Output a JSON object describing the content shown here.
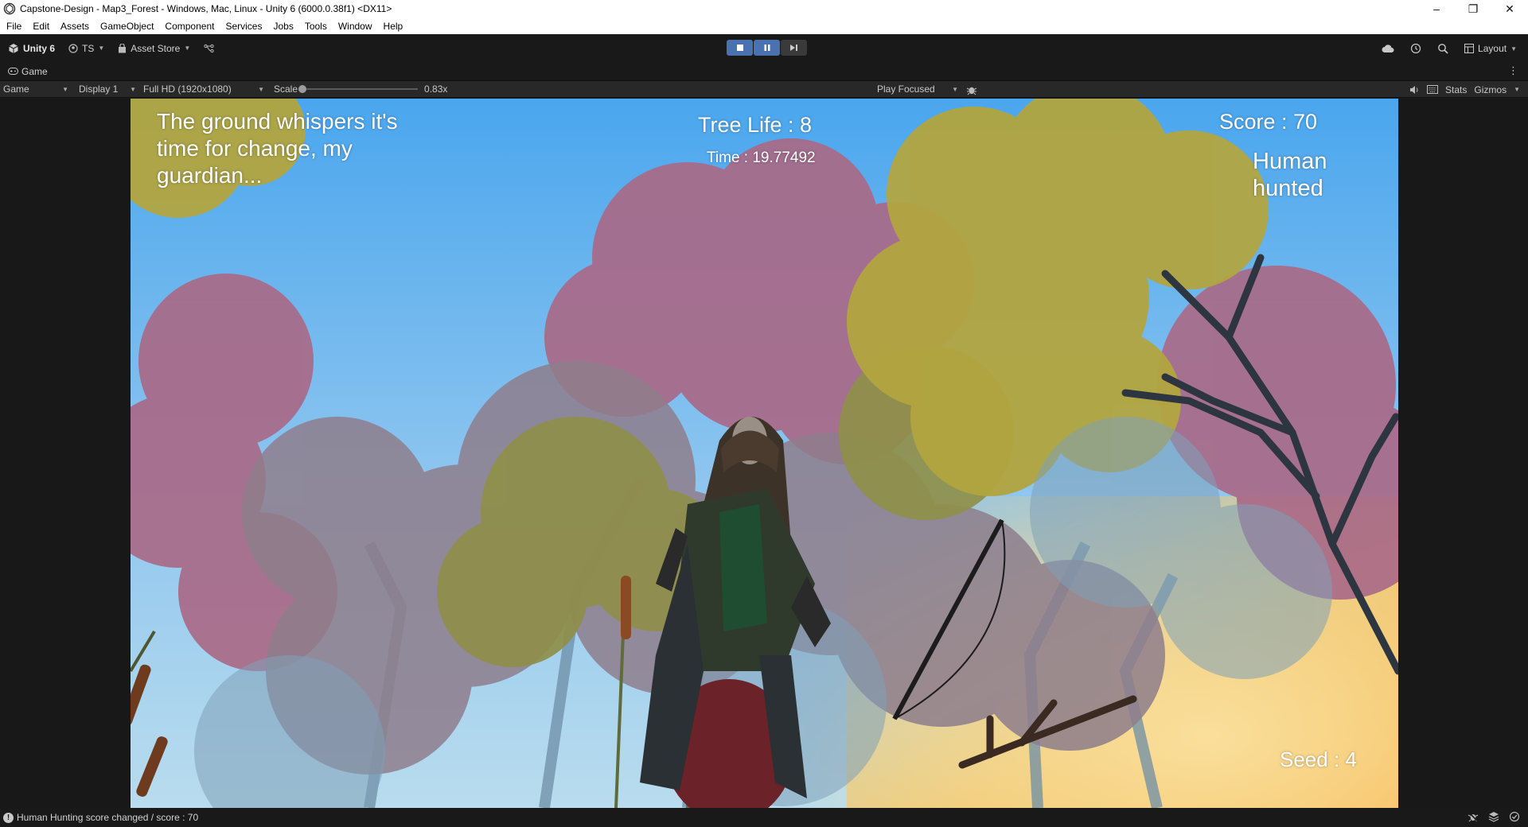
{
  "window": {
    "title": "Capstone-Design - Map3_Forest - Windows, Mac, Linux - Unity 6 (6000.0.38f1) <DX11>",
    "minimize": "–",
    "maximize": "❐",
    "close": "✕"
  },
  "menu": [
    "File",
    "Edit",
    "Assets",
    "GameObject",
    "Component",
    "Services",
    "Jobs",
    "Tools",
    "Window",
    "Help"
  ],
  "toolbar": {
    "unity_label": "Unity 6",
    "account_label": "TS",
    "asset_store_label": "Asset Store",
    "layout_label": "Layout",
    "play_state": "playing"
  },
  "tab": {
    "label": "Game"
  },
  "gamebar": {
    "mode": "Game",
    "display": "Display 1",
    "resolution": "Full HD (1920x1080)",
    "scale_label": "Scale",
    "scale_value": "0.83x",
    "scale_fraction": 0.0,
    "play_focused": "Play Focused",
    "stats": "Stats",
    "gizmos": "Gizmos"
  },
  "hud": {
    "message": "The ground whispers it's time for change, my guardian...",
    "tree_life": "Tree Life : 8",
    "time": "Time : 19.77492",
    "score": "Score : 70",
    "event": "Human hunted",
    "seed": "Seed : 4"
  },
  "status": {
    "message": "Human Hunting score changed / score : 70"
  },
  "colors": {
    "editor_bg": "#191919",
    "play_active": "#4a72b0",
    "sky_top": "#4aa6ee",
    "sky_bottom": "#a9d3f0"
  }
}
